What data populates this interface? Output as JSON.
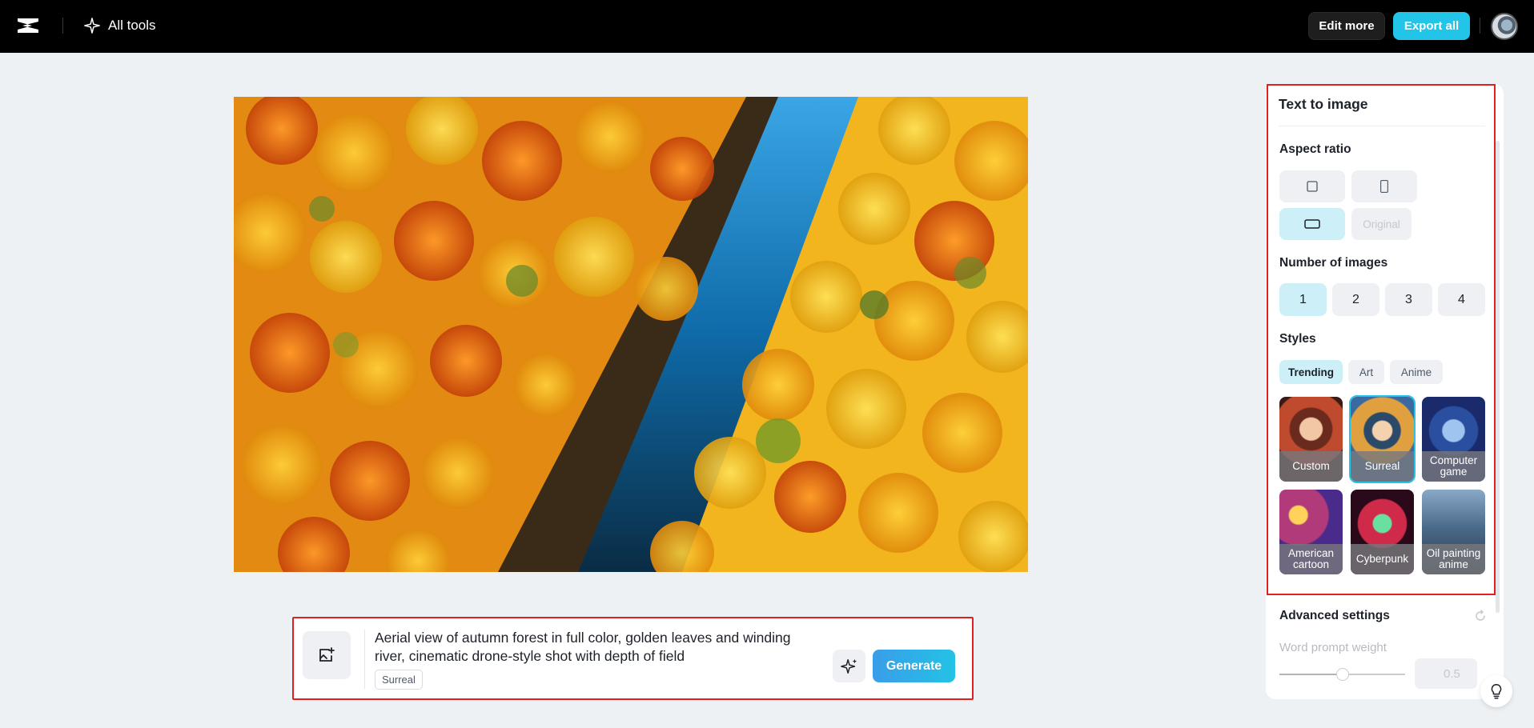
{
  "topbar": {
    "logo_icon": "capcut-logo-icon",
    "all_tools_label": "All tools",
    "edit_more_label": "Edit more",
    "export_all_label": "Export all",
    "accent_color": "#22c4e8"
  },
  "main_image": {
    "description_icon": "generated-image"
  },
  "prompt": {
    "text": "Aerial view of autumn forest in full color, golden leaves and winding river, cinematic drone-style shot with depth of field",
    "style_tag": "Surreal",
    "generate_label": "Generate"
  },
  "panel": {
    "title": "Text to image",
    "aspect_ratio": {
      "label": "Aspect ratio",
      "options": [
        "square",
        "portrait",
        "landscape",
        "Original"
      ],
      "selected": "landscape",
      "original_label": "Original"
    },
    "number_of_images": {
      "label": "Number of images",
      "options": [
        "1",
        "2",
        "3",
        "4"
      ],
      "selected": "1"
    },
    "styles": {
      "label": "Styles",
      "tabs": [
        "Trending",
        "Art",
        "Anime"
      ],
      "selected_tab": "Trending",
      "cards": [
        {
          "name": "Custom"
        },
        {
          "name": "Surreal"
        },
        {
          "name": "Computer game"
        },
        {
          "name": "American cartoon"
        },
        {
          "name": "Cyberpunk"
        },
        {
          "name": "Oil painting anime"
        }
      ],
      "selected_card": "Surreal"
    },
    "advanced": {
      "label": "Advanced settings",
      "weight_label": "Word prompt weight",
      "weight_value": "0.5",
      "weight_fraction": 0.5
    }
  }
}
